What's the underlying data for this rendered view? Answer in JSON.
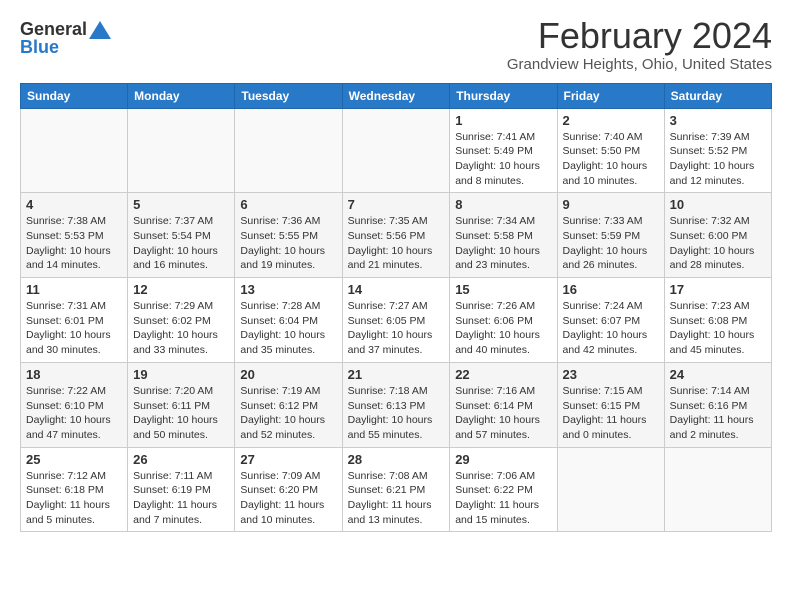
{
  "header": {
    "logo_line1": "General",
    "logo_line2": "Blue",
    "title": "February 2024",
    "subtitle": "Grandview Heights, Ohio, United States"
  },
  "weekdays": [
    "Sunday",
    "Monday",
    "Tuesday",
    "Wednesday",
    "Thursday",
    "Friday",
    "Saturday"
  ],
  "weeks": [
    [
      {
        "day": "",
        "info": ""
      },
      {
        "day": "",
        "info": ""
      },
      {
        "day": "",
        "info": ""
      },
      {
        "day": "",
        "info": ""
      },
      {
        "day": "1",
        "info": "Sunrise: 7:41 AM\nSunset: 5:49 PM\nDaylight: 10 hours\nand 8 minutes."
      },
      {
        "day": "2",
        "info": "Sunrise: 7:40 AM\nSunset: 5:50 PM\nDaylight: 10 hours\nand 10 minutes."
      },
      {
        "day": "3",
        "info": "Sunrise: 7:39 AM\nSunset: 5:52 PM\nDaylight: 10 hours\nand 12 minutes."
      }
    ],
    [
      {
        "day": "4",
        "info": "Sunrise: 7:38 AM\nSunset: 5:53 PM\nDaylight: 10 hours\nand 14 minutes."
      },
      {
        "day": "5",
        "info": "Sunrise: 7:37 AM\nSunset: 5:54 PM\nDaylight: 10 hours\nand 16 minutes."
      },
      {
        "day": "6",
        "info": "Sunrise: 7:36 AM\nSunset: 5:55 PM\nDaylight: 10 hours\nand 19 minutes."
      },
      {
        "day": "7",
        "info": "Sunrise: 7:35 AM\nSunset: 5:56 PM\nDaylight: 10 hours\nand 21 minutes."
      },
      {
        "day": "8",
        "info": "Sunrise: 7:34 AM\nSunset: 5:58 PM\nDaylight: 10 hours\nand 23 minutes."
      },
      {
        "day": "9",
        "info": "Sunrise: 7:33 AM\nSunset: 5:59 PM\nDaylight: 10 hours\nand 26 minutes."
      },
      {
        "day": "10",
        "info": "Sunrise: 7:32 AM\nSunset: 6:00 PM\nDaylight: 10 hours\nand 28 minutes."
      }
    ],
    [
      {
        "day": "11",
        "info": "Sunrise: 7:31 AM\nSunset: 6:01 PM\nDaylight: 10 hours\nand 30 minutes."
      },
      {
        "day": "12",
        "info": "Sunrise: 7:29 AM\nSunset: 6:02 PM\nDaylight: 10 hours\nand 33 minutes."
      },
      {
        "day": "13",
        "info": "Sunrise: 7:28 AM\nSunset: 6:04 PM\nDaylight: 10 hours\nand 35 minutes."
      },
      {
        "day": "14",
        "info": "Sunrise: 7:27 AM\nSunset: 6:05 PM\nDaylight: 10 hours\nand 37 minutes."
      },
      {
        "day": "15",
        "info": "Sunrise: 7:26 AM\nSunset: 6:06 PM\nDaylight: 10 hours\nand 40 minutes."
      },
      {
        "day": "16",
        "info": "Sunrise: 7:24 AM\nSunset: 6:07 PM\nDaylight: 10 hours\nand 42 minutes."
      },
      {
        "day": "17",
        "info": "Sunrise: 7:23 AM\nSunset: 6:08 PM\nDaylight: 10 hours\nand 45 minutes."
      }
    ],
    [
      {
        "day": "18",
        "info": "Sunrise: 7:22 AM\nSunset: 6:10 PM\nDaylight: 10 hours\nand 47 minutes."
      },
      {
        "day": "19",
        "info": "Sunrise: 7:20 AM\nSunset: 6:11 PM\nDaylight: 10 hours\nand 50 minutes."
      },
      {
        "day": "20",
        "info": "Sunrise: 7:19 AM\nSunset: 6:12 PM\nDaylight: 10 hours\nand 52 minutes."
      },
      {
        "day": "21",
        "info": "Sunrise: 7:18 AM\nSunset: 6:13 PM\nDaylight: 10 hours\nand 55 minutes."
      },
      {
        "day": "22",
        "info": "Sunrise: 7:16 AM\nSunset: 6:14 PM\nDaylight: 10 hours\nand 57 minutes."
      },
      {
        "day": "23",
        "info": "Sunrise: 7:15 AM\nSunset: 6:15 PM\nDaylight: 11 hours\nand 0 minutes."
      },
      {
        "day": "24",
        "info": "Sunrise: 7:14 AM\nSunset: 6:16 PM\nDaylight: 11 hours\nand 2 minutes."
      }
    ],
    [
      {
        "day": "25",
        "info": "Sunrise: 7:12 AM\nSunset: 6:18 PM\nDaylight: 11 hours\nand 5 minutes."
      },
      {
        "day": "26",
        "info": "Sunrise: 7:11 AM\nSunset: 6:19 PM\nDaylight: 11 hours\nand 7 minutes."
      },
      {
        "day": "27",
        "info": "Sunrise: 7:09 AM\nSunset: 6:20 PM\nDaylight: 11 hours\nand 10 minutes."
      },
      {
        "day": "28",
        "info": "Sunrise: 7:08 AM\nSunset: 6:21 PM\nDaylight: 11 hours\nand 13 minutes."
      },
      {
        "day": "29",
        "info": "Sunrise: 7:06 AM\nSunset: 6:22 PM\nDaylight: 11 hours\nand 15 minutes."
      },
      {
        "day": "",
        "info": ""
      },
      {
        "day": "",
        "info": ""
      }
    ]
  ]
}
